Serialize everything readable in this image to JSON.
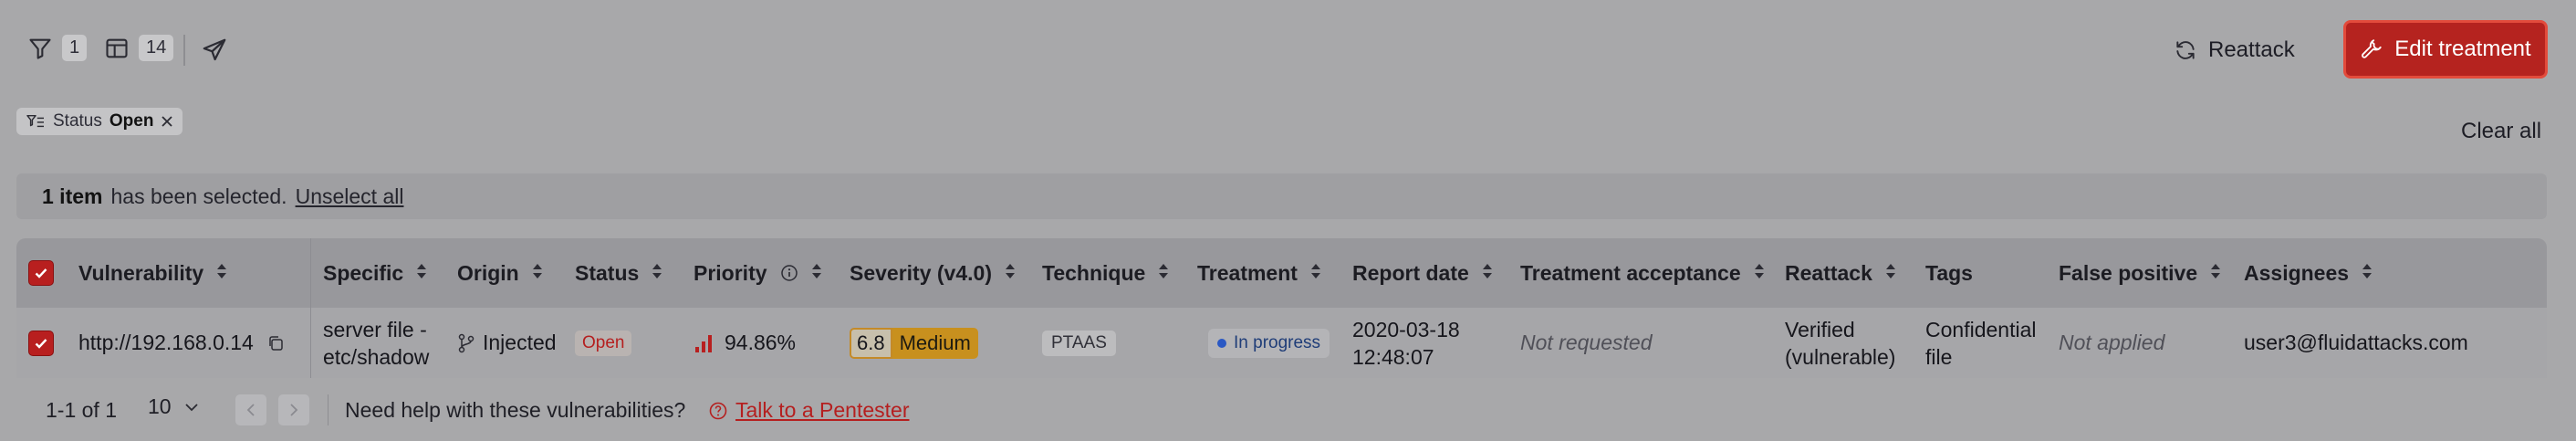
{
  "toolbar": {
    "filter_count": "1",
    "columns_count": "14",
    "reattack_label": "Reattack",
    "edit_treatment_label": "Edit treatment"
  },
  "filters": {
    "chip_label": "Status",
    "chip_value": "Open",
    "clear_all": "Clear all"
  },
  "selection": {
    "count_text": "1 item",
    "message": "has been selected.",
    "unselect_label": "Unselect all"
  },
  "table": {
    "columns": [
      "Vulnerability",
      "Specific",
      "Origin",
      "Status",
      "Priority",
      "Severity (v4.0)",
      "Technique",
      "Treatment",
      "Report date",
      "Treatment acceptance",
      "Reattack",
      "Tags",
      "False positive",
      "Assignees"
    ],
    "rows": [
      {
        "vulnerability": "http://192.168.0.14",
        "specific_line1": "server file -",
        "specific_line2": "etc/shadow",
        "origin": "Injected",
        "status": "Open",
        "priority": "94.86%",
        "severity_score": "6.8",
        "severity_label": "Medium",
        "technique": "PTAAS",
        "treatment": "In progress",
        "report_date_line1": "2020-03-18",
        "report_date_line2": "12:48:07",
        "treatment_acceptance": "Not requested",
        "reattack_line1": "Verified",
        "reattack_line2": "(vulnerable)",
        "tags_line1": "Confidential",
        "tags_line2": "file",
        "false_positive": "Not applied",
        "assignees": "user3@fluidattacks.com"
      }
    ]
  },
  "footer": {
    "range": "1-1 of 1",
    "page_size": "10",
    "help_text": "Need help with these vulnerabilities?",
    "talk_link": "Talk to a Pentester"
  },
  "colors": {
    "accent": "#b5231f",
    "overlay_bg": "#a8a8aa"
  },
  "icons": [
    "filter-icon",
    "columns-icon",
    "send-icon",
    "refresh-icon",
    "wrench-icon",
    "close-icon",
    "copy-icon",
    "branch-icon",
    "info-icon",
    "sort-icon",
    "chevron-down-icon",
    "chevron-left-icon",
    "chevron-right-icon",
    "help-circle-icon"
  ]
}
